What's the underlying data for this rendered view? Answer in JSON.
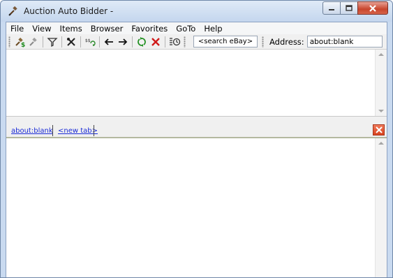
{
  "window": {
    "title": "Auction Auto Bidder -"
  },
  "menu": {
    "items": [
      "File",
      "View",
      "Items",
      "Browser",
      "Favorites",
      "GoTo",
      "Help"
    ]
  },
  "toolbar": {
    "buttons": [
      "bid-dollar-icon",
      "gavel-icon",
      "filter-icon",
      "tools-icon",
      "refresh-items-icon",
      "back-arrow-icon",
      "forward-arrow-icon",
      "reload-icon",
      "stop-icon",
      "timer-icon"
    ],
    "search_placeholder": "<search eBay>",
    "address_label": "Address:",
    "address_value": "about:blank"
  },
  "tabs": {
    "items": [
      {
        "label": "about:blank",
        "active": true
      },
      {
        "label": "<new tab>",
        "active": false
      }
    ]
  },
  "colors": {
    "close_button": "#c8452c",
    "tab_link": "#1a2bd6",
    "title_bar": "#c9daf0"
  }
}
